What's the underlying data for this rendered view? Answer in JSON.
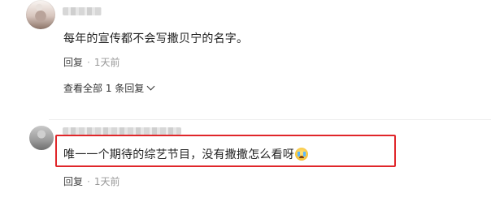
{
  "comments": [
    {
      "text": "每年的宣传都不会写撒贝宁的名字。",
      "reply_label": "回复",
      "separator": "·",
      "time": "1天前",
      "view_replies": "查看全部 1 条回复"
    },
    {
      "text": "唯一一个期待的综艺节目，没有撒撒怎么看呀",
      "emoji": "crying-face-icon",
      "reply_label": "回复",
      "separator": "·",
      "time": "1天前"
    }
  ],
  "colors": {
    "highlight_border": "#e0262a",
    "text": "#222222",
    "meta": "#999999"
  }
}
